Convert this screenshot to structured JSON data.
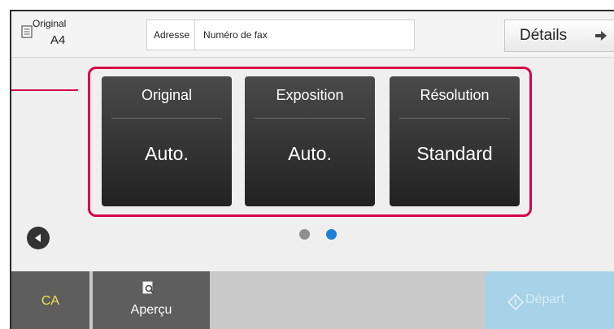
{
  "header": {
    "original_label": "Original",
    "original_size": "A4",
    "address_label": "Adresse",
    "address_value": "Numéro de fax",
    "details_label": "Détails"
  },
  "panels": [
    {
      "title": "Original",
      "value": "Auto."
    },
    {
      "title": "Exposition",
      "value": "Auto."
    },
    {
      "title": "Résolution",
      "value": "Standard"
    }
  ],
  "pager": {
    "pages": 2,
    "current": 2
  },
  "footer": {
    "ca_label": "CA",
    "preview_label": "Aperçu",
    "start_label": "Départ"
  },
  "colors": {
    "highlight": "#d6004a",
    "ca_text": "#f2e04a",
    "active_dot": "#1e7fd6",
    "start_button": "#a8d2e8"
  },
  "icons": {
    "original": "document-icon",
    "details": "arrow-right-icon",
    "previous": "chevron-left-icon",
    "preview": "magnifier-document-icon",
    "start": "start-diamond-icon"
  }
}
